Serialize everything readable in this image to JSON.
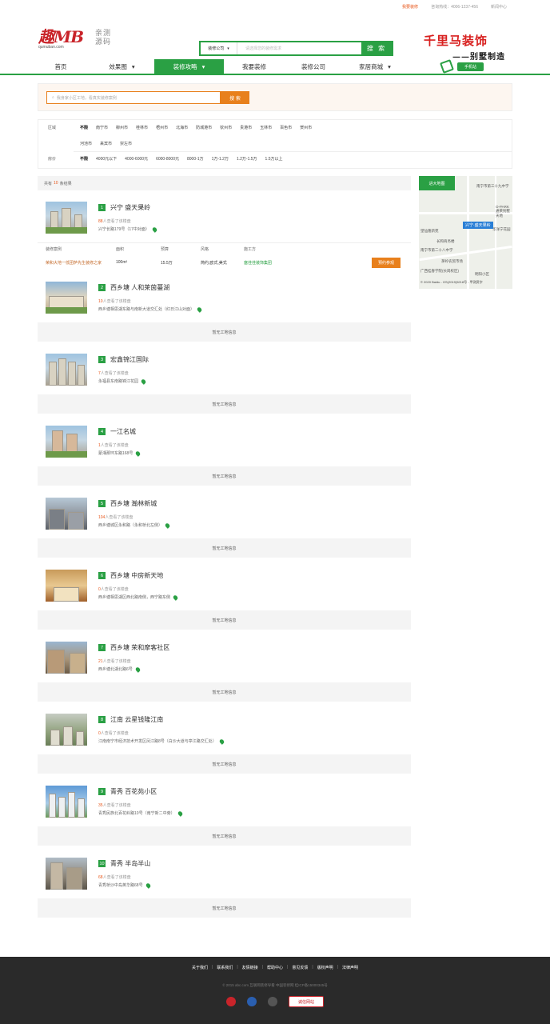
{
  "topbar": {
    "links": [
      "我要装修",
      "咨询热线：4006-1237-456",
      "新闻中心"
    ]
  },
  "logo": {
    "main": "趣MB",
    "sub": "qumuban.com",
    "side1": "亲测",
    "side2": "源码"
  },
  "search": {
    "select": "装修公司",
    "placeholder": "请选择您的装修需求",
    "button": "搜 索"
  },
  "brand": {
    "line1": "千里马装饰",
    "line2": "——别墅制造"
  },
  "nav": {
    "items": [
      "首页",
      "效果图",
      "装修攻略",
      "我要装修",
      "装修公司",
      "家居商城"
    ],
    "mobile": "手机站"
  },
  "secsearch": {
    "placeholder": "我身家小区工地，看真实装修案例",
    "button": "搜 索"
  },
  "filter": {
    "area_label": "区域",
    "area_row1": [
      "不限",
      "南宁市",
      "柳州市",
      "桂林市",
      "梧州市",
      "北海市",
      "防城港市",
      "钦州市",
      "贵港市",
      "玉林市",
      "百色市",
      "贺州市"
    ],
    "area_row2": [
      "河池市",
      "来宾市",
      "崇左市"
    ],
    "price_label": "房价",
    "price": [
      "不限",
      "4000元以下",
      "4000-6000元",
      "6000-8000元",
      "8000-1万",
      "1万-1.2万",
      "1.2万-1.5万",
      "1.5万以上"
    ]
  },
  "results": {
    "prefix": "共有",
    "count": "10",
    "suffix": "条结果"
  },
  "map": {
    "button": "进大地图",
    "pin": "兴宁·盛天果岭",
    "copyright": "© 2020 Baidu - GS(2019)5218号 - 甲测资字",
    "labels": [
      "南宁市第三十九中学",
      "O-PARK通莱别墅天地",
      "望仙隆新苑",
      "长和商务楼",
      "茅岭农贸市场",
      "南宁市第二十八中学",
      "广西桂春学院(长岗校区)",
      "明阳小区",
      "华洋宁花园"
    ]
  },
  "case_table": {
    "headers": [
      "装修案例",
      "面积",
      "预算",
      "风格",
      "施工方"
    ],
    "row": {
      "name": "荣和大地一低团萨先生装修之家",
      "area": "100m²",
      "budget": "15.5万",
      "style": "简约,欧式,美式",
      "company": "塞佳佳装饰集团",
      "button": "预约参观"
    }
  },
  "items": [
    {
      "idx": "1",
      "title": "兴宁 盛天果岭",
      "views_n": "88",
      "views": "人查看了该楼盘",
      "addr": "兴宁长路179号（17中对面）",
      "nosite": ""
    },
    {
      "idx": "2",
      "title": "西乡塘 人和莱茵蔓湖",
      "views_n": "10",
      "views": "人查看了该楼盘",
      "addr": "西乡塘相思湖东路与南新大道交汇处（红日江山对面）",
      "nosite": "暂无工地信息"
    },
    {
      "idx": "3",
      "title": "宏鑫锦江国际",
      "views_n": "7",
      "views": "人查看了该楼盘",
      "addr": "永福县东南路锦江花园",
      "nosite": "暂无工地信息"
    },
    {
      "idx": "4",
      "title": "一江名城",
      "views_n": "1",
      "views": "人查看了该楼盘",
      "addr": "蒙湘那环东路168号",
      "nosite": "暂无工地信息"
    },
    {
      "idx": "5",
      "title": "西乡塘 瀚林新城",
      "views_n": "104",
      "views": "人查看了该楼盘",
      "addr": "西乡塘城区永和路（永和桥北左侧）",
      "nosite": "暂无工地信息"
    },
    {
      "idx": "6",
      "title": "西乡塘 中房新天地",
      "views_n": "0",
      "views": "人查看了该楼盘",
      "addr": "西乡塘相思湖区西北路南侧，西宁路东侧",
      "nosite": "暂无工地信息"
    },
    {
      "idx": "7",
      "title": "西乡塘 荣和摩客社区",
      "views_n": "21",
      "views": "人查看了该楼盘",
      "addr": "西乡塘北湖北路6号",
      "nosite": "暂无工地信息"
    },
    {
      "idx": "8",
      "title": "江南 云星钱隆江南",
      "views_n": "0",
      "views": "人查看了该楼盘",
      "addr": "江南南宁市经济技术开发区凤江路8号（白沙大道与亭江路交汇处）",
      "nosite": "暂无工地信息"
    },
    {
      "idx": "9",
      "title": "青秀 百花苑小区",
      "views_n": "35",
      "views": "人查看了该楼盘",
      "addr": "青秀民族北百花岭路10号（南宁新二中旁）",
      "nosite": "暂无工地信息"
    },
    {
      "idx": "10",
      "title": "青秀 半岛半山",
      "views_n": "68",
      "views": "人查看了该楼盘",
      "addr": "青秀桥沙中岛英华路68号",
      "nosite": "暂无工地信息"
    }
  ],
  "footer": {
    "links": [
      "关于我们",
      "联系我们",
      "友情链接",
      "帮助中心",
      "意见反馈",
      "版权声明",
      "法律声明"
    ],
    "copy": "© 2015 abc.com 互联网装修导看 中国装修网 桂ICP备15000345号",
    "cheng": "诚信网站"
  }
}
